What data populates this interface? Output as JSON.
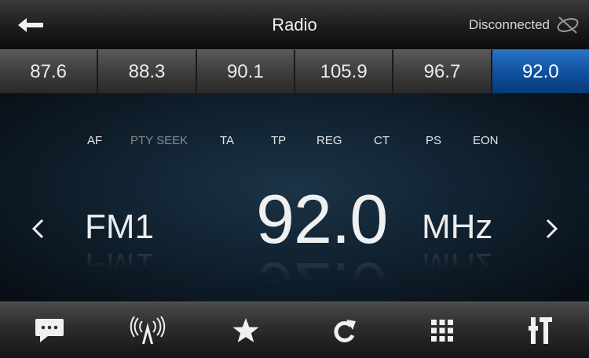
{
  "header": {
    "title": "Radio",
    "status_text": "Disconnected",
    "icons": {
      "back": "back-arrow-icon",
      "status": "satellite-disconnected-icon"
    }
  },
  "presets": [
    "87.6",
    "88.3",
    "90.1",
    "105.9",
    "96.7",
    "92.0"
  ],
  "active_preset": "92.0",
  "rds": {
    "af": "AF",
    "pty_seek": "PTY SEEK",
    "ta": "TA",
    "tp": "TP",
    "reg": "REG",
    "ct": "CT",
    "ps": "PS",
    "eon": "EON"
  },
  "tuner": {
    "band": "FM1",
    "frequency": "92.0",
    "unit": "MHz",
    "prev_symbol": "<",
    "next_symbol": ">"
  },
  "toolbar": {
    "icons": [
      "message-icon",
      "broadcast-antenna-icon",
      "star-icon",
      "refresh-icon",
      "grid-icon",
      "settings-icon"
    ]
  },
  "colors": {
    "accent_blue": "#0e4f9d",
    "preset_gray": "#3e3e3e",
    "background": "#0f1e2b"
  }
}
